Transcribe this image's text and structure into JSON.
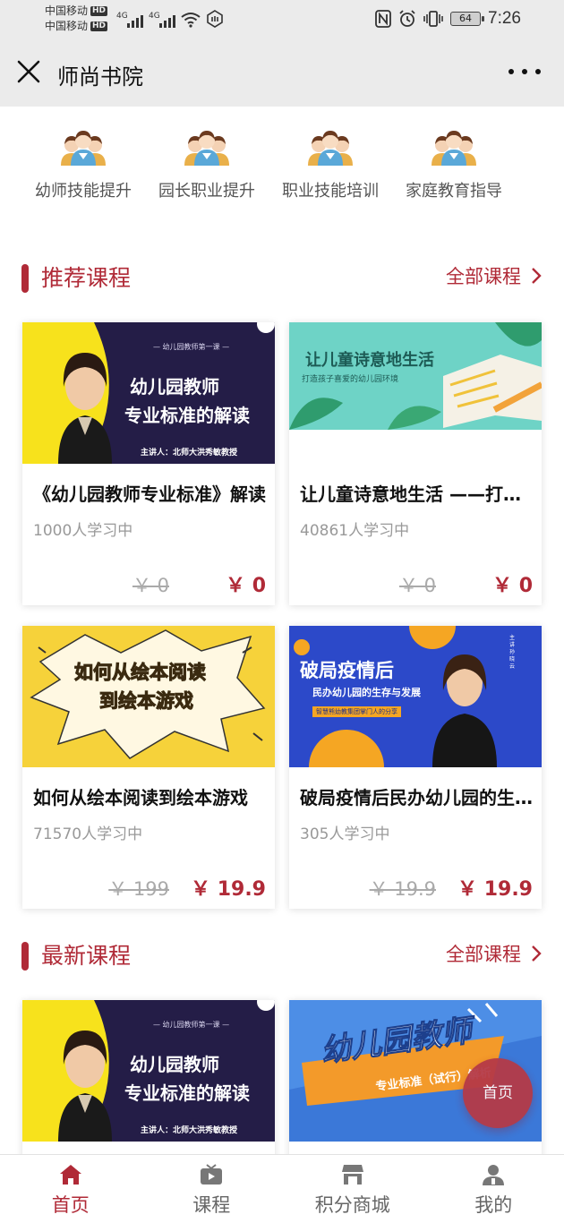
{
  "status_bar": {
    "carrier_1": "中国移动",
    "carrier_2": "中国移动",
    "hd_1": "HD",
    "hd_2": "HD",
    "network_1": "4G",
    "network_2": "4G",
    "battery": "64",
    "time": "7:26",
    "icons": [
      "wifi-icon",
      "hotspot-icon",
      "nfc-icon",
      "alarm-icon",
      "vibrate-icon"
    ]
  },
  "header": {
    "title": "师尚书院",
    "close_icon": "close-icon",
    "more_icon": "more-icon"
  },
  "categories": [
    {
      "label": "幼师技能提升",
      "icon": "group-icon"
    },
    {
      "label": "园长职业提升",
      "icon": "group-icon"
    },
    {
      "label": "职业技能培训",
      "icon": "group-icon"
    },
    {
      "label": "家庭教育指导",
      "icon": "group-icon"
    }
  ],
  "recommended": {
    "title": "推荐课程",
    "more_label": "全部课程",
    "courses": [
      {
        "title": "《幼儿园教师专业标准》解读",
        "learners": "1000人学习中",
        "original_price": "￥ 0",
        "price": "￥ 0",
        "thumb_small": "— 幼儿园教师第一课 —",
        "thumb_line1": "幼儿园教师",
        "thumb_line2": "专业标准的解读",
        "thumb_speaker": "主讲人：北师大洪秀敏教授"
      },
      {
        "title": "让儿童诗意地生活 ——打造孩子喜爱的幼儿园环境",
        "learners": "40861人学习中",
        "original_price": "￥ 0",
        "price": "￥ 0",
        "thumb_line1": "让儿童诗意地生活",
        "thumb_line2": "打造孩子喜爱的幼儿园环境"
      },
      {
        "title": "如何从绘本阅读到绘本游戏",
        "learners": "71570人学习中",
        "original_price": "￥ 199",
        "price": "￥ 19.9",
        "thumb_line1": "如何从绘本阅读",
        "thumb_line2": "到绘本游戏"
      },
      {
        "title": "破局疫情后民办幼儿园的生存与发展",
        "learners": "305人学习中",
        "original_price": "￥ 19.9",
        "price": "￥ 19.9",
        "thumb_line1": "破局疫情后",
        "thumb_line2": "民办幼儿园的生存与发展",
        "thumb_note": "智慧熊幼教集团掌门人的分享",
        "thumb_speaker": "主讲 孙晓云"
      }
    ]
  },
  "latest": {
    "title": "最新课程",
    "more_label": "全部课程",
    "courses": [
      {
        "thumb_small": "— 幼儿园教师第一课 —",
        "thumb_line1": "幼儿园教师",
        "thumb_line2": "专业标准的解读",
        "thumb_speaker": "主讲人：北师大洪秀敏教授"
      },
      {
        "thumb_line1": "幼儿园教师",
        "thumb_line2": "专业标准（试行）解析"
      }
    ]
  },
  "fab_label": "首页",
  "tabs": [
    {
      "label": "首页",
      "icon": "home-icon",
      "active": true
    },
    {
      "label": "课程",
      "icon": "tv-icon",
      "active": false
    },
    {
      "label": "积分商城",
      "icon": "store-icon",
      "active": false
    },
    {
      "label": "我的",
      "icon": "user-icon",
      "active": false
    }
  ],
  "colors": {
    "accent": "#b02a37",
    "status_bar_bg": "#ebebeb",
    "price_strike": "#aaaaaa"
  }
}
